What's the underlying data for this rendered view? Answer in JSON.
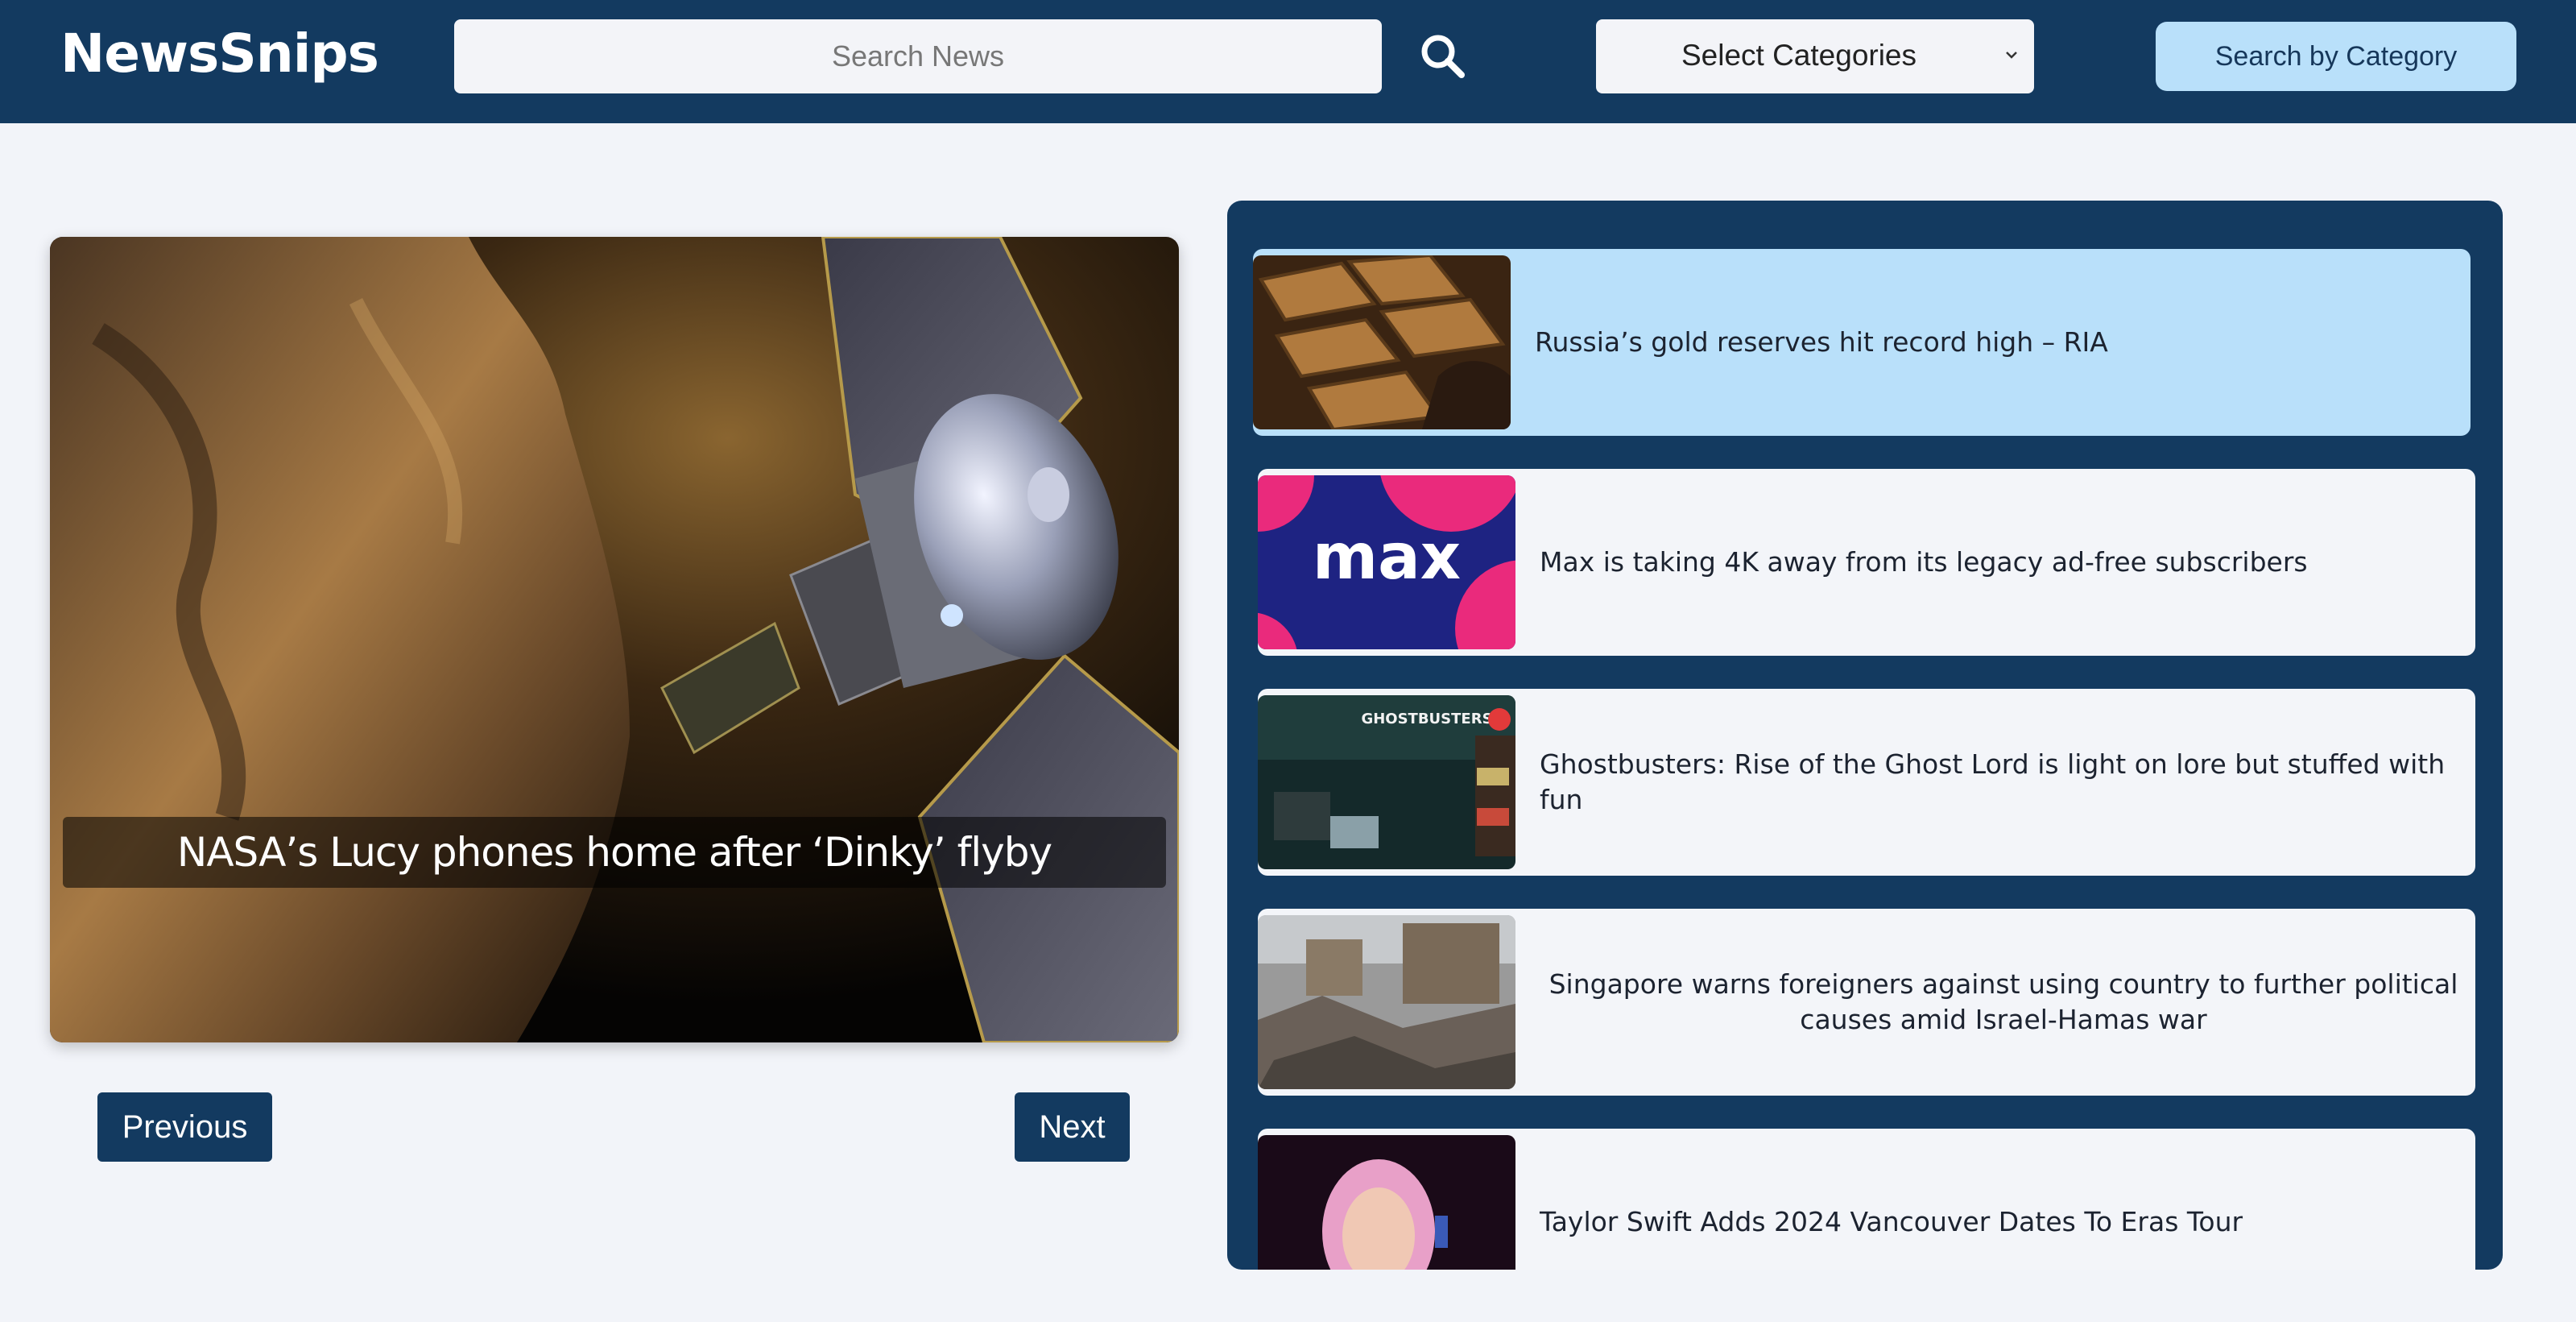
{
  "app": {
    "brand": "NewsSnips"
  },
  "header": {
    "search_placeholder": "Search News",
    "category_select": "Select Categories",
    "category_button": "Search by Category"
  },
  "featured": {
    "title": "NASA’s Lucy phones home after ‘Dinky’ flyby"
  },
  "pager": {
    "previous": "Previous",
    "next": "Next"
  },
  "articles": [
    {
      "title": "Russia’s gold reserves hit record high – RIA"
    },
    {
      "title": "Max is taking 4K away from its legacy ad-free subscribers",
      "thumb_text": "max"
    },
    {
      "title": "Ghostbusters: Rise of the Ghost Lord is light on lore but stuffed with fun",
      "thumb_text": "GHOSTBUSTERS"
    },
    {
      "title": "Singapore warns foreigners against using country to further political causes amid Israel-Hamas war"
    },
    {
      "title": "Taylor Swift Adds 2024 Vancouver Dates To Eras Tour"
    }
  ],
  "colors": {
    "nav": "#133a60",
    "accent": "#b9e0fa",
    "page_bg": "#f2f4f9",
    "card_bg": "#f3f5f9"
  },
  "icons": {
    "search": "search-icon",
    "select_arrow": "chevron-down-icon"
  }
}
